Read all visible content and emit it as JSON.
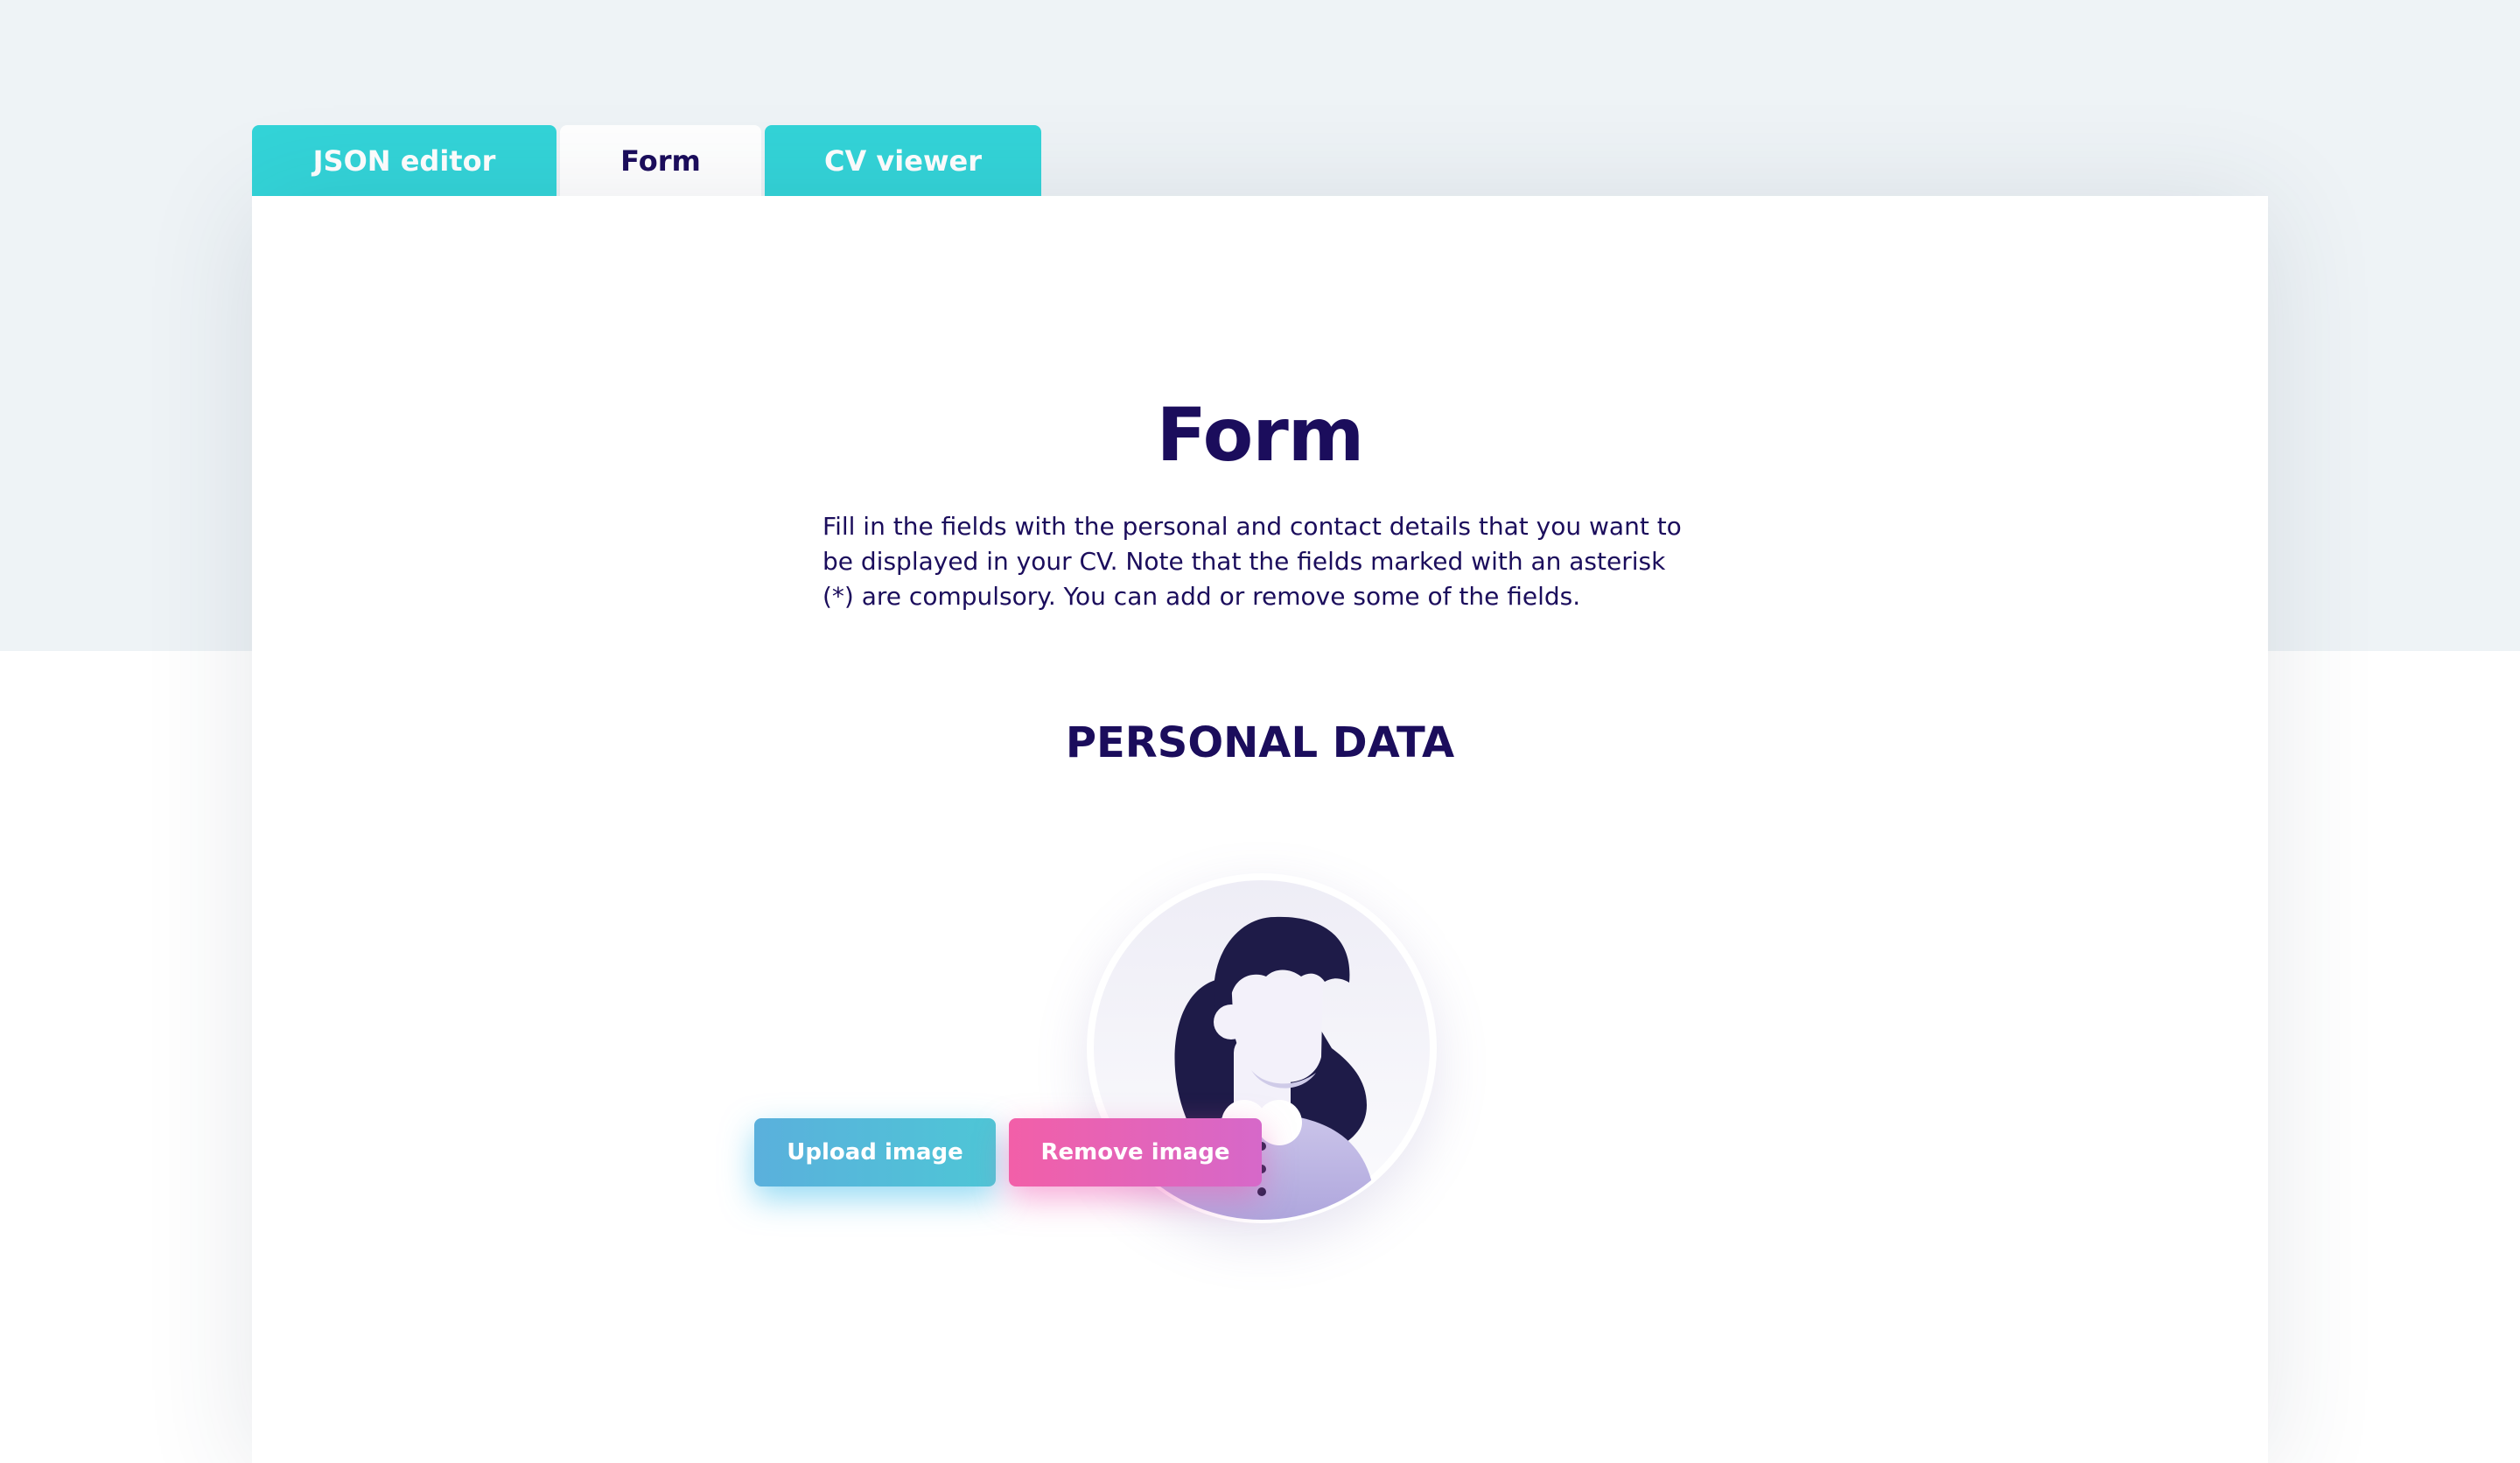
{
  "tabs": [
    {
      "label": "JSON editor",
      "active": false
    },
    {
      "label": "Form",
      "active": true
    },
    {
      "label": "CV viewer",
      "active": false
    }
  ],
  "form": {
    "title": "Form",
    "intro": "Fill in the fields with the personal and contact details that you want to be displayed in your CV. Note that the fields marked with an asterisk (*) are compulsory. You can add or remove some of the fields.",
    "section_title": "PERSONAL DATA"
  },
  "avatar": {
    "icon": "avatar-placeholder-icon"
  },
  "buttons": {
    "upload_label": "Upload image",
    "remove_label": "Remove image"
  },
  "colors": {
    "background_top": "#eef3f6",
    "tab_inactive": "#33d4d8",
    "text_primary": "#1b0d5c",
    "upload_gradient_start": "#5ab0dc",
    "upload_gradient_end": "#4ec6d6",
    "remove_gradient_start": "#f25fa8",
    "remove_gradient_end": "#d668c9"
  }
}
